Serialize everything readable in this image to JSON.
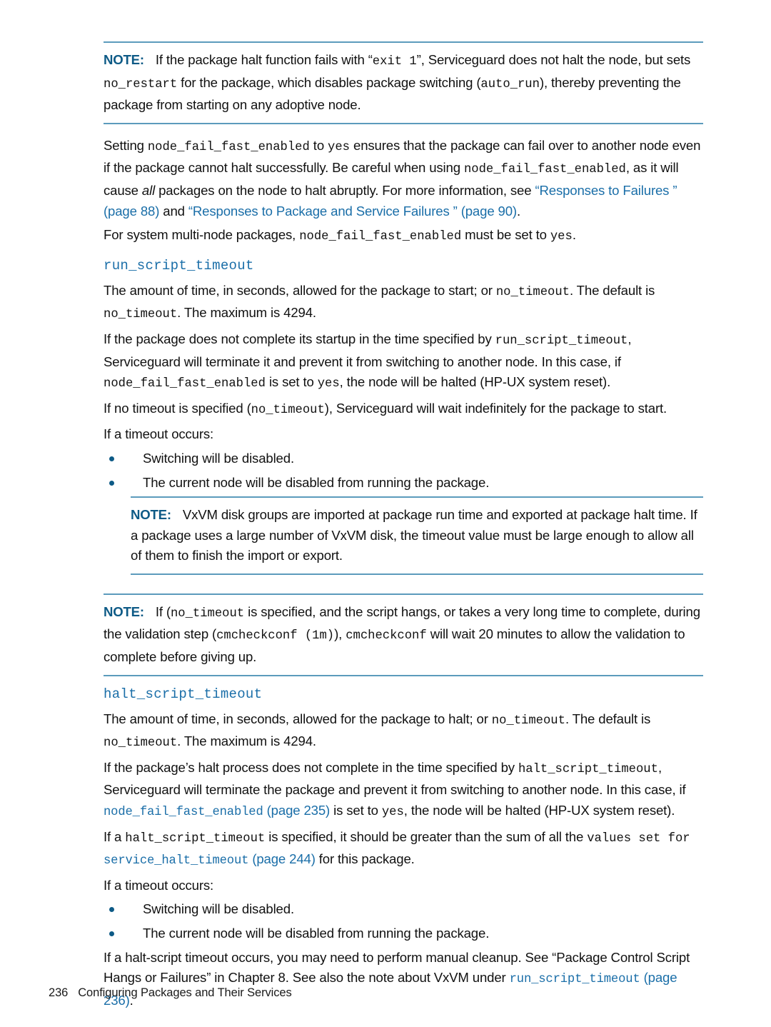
{
  "document": {
    "footer": {
      "page_number": "236",
      "chapter_title": "Configuring Packages and Their Services"
    }
  },
  "notes": {
    "note1": {
      "label": "NOTE:",
      "seg1": "If the package halt function fails with “",
      "code1": "exit 1",
      "seg2": "”, Serviceguard does not halt the node, but sets ",
      "code2": "no_restart",
      "seg3": " for the package, which disables package switching (",
      "code3": "auto_run",
      "seg4": "), thereby preventing the package from starting on any adoptive node."
    },
    "note2": {
      "label": "NOTE:",
      "seg1": "VxVM disk groups are imported at package run time and exported at package halt time. If a package uses a large number of VxVM disk, the timeout value must be large enough to allow all of them to finish the import or export."
    },
    "note3": {
      "label": "NOTE:",
      "seg1": "If (",
      "code1": "no_timeout",
      "seg2": " is specified, and the script hangs, or takes a very long time to complete, during the validation step (",
      "code2": "cmcheckconf (1m)",
      "seg3": "), ",
      "code3": "cmcheckconf",
      "seg4": " will wait 20 minutes to allow the validation to complete before giving up."
    }
  },
  "intro": {
    "para1": {
      "seg1": "Setting ",
      "code1": "node_fail_fast_enabled",
      "seg2": " to ",
      "code2": "yes",
      "seg3": " ensures that the package can fail over to another node even if the package cannot halt successfully. Be careful when using ",
      "code3": "node_fail_fast_enabled",
      "seg4": ", as it will cause ",
      "emph": "all",
      "seg5": " packages on the node to halt abruptly. For more information, see ",
      "link1": "“Responses to Failures ” (page 88)",
      "seg6": " and ",
      "link2": "“Responses to Package and Service Failures ” (page 90)",
      "seg7": "."
    },
    "para2": {
      "seg1": "For system multi-node packages, ",
      "code1": "node_fail_fast_enabled",
      "seg2": " must be set to ",
      "code2": "yes",
      "seg3": "."
    }
  },
  "run_script_timeout": {
    "heading": "run_script_timeout",
    "para1": {
      "seg1": "The amount of time, in seconds, allowed for the package to start; or ",
      "code1": "no_timeout",
      "seg2": ". The default is ",
      "code2": "no_timeout",
      "seg3": ". The maximum is 4294."
    },
    "para2": {
      "seg1": "If the package does not complete its startup in the time specified by ",
      "code1": "run_script_timeout",
      "seg2": ", Serviceguard will terminate it and prevent it from switching to another node. In this case, if ",
      "code2": "node_fail_fast_enabled",
      "seg3": " is set to ",
      "code3": "yes",
      "seg4": ", the node will be halted (HP-UX system reset)."
    },
    "para3": {
      "seg1": "If no timeout is specified (",
      "code1": "no_timeout",
      "seg2": "), Serviceguard will wait indefinitely for the package to start."
    },
    "para4": "If a timeout occurs:",
    "bullets": [
      "Switching will be disabled.",
      "The current node will be disabled from running the package."
    ]
  },
  "halt_script_timeout": {
    "heading": "halt_script_timeout",
    "para1": {
      "seg1": "The amount of time, in seconds, allowed for the package to halt; or ",
      "code1": "no_timeout",
      "seg2": ". The default is ",
      "code2": "no_timeout",
      "seg3": ". The maximum is 4294."
    },
    "para2": {
      "seg1": "If the package’s halt process does not complete in the time specified by ",
      "code1": "halt_script_timeout",
      "seg2": ", Serviceguard will terminate the package and prevent it from switching to another node. In this case, if ",
      "link1": "node_fail_fast_enabled",
      "link1_page": " (page 235)",
      "seg3": " is set to ",
      "code2": "yes",
      "seg4": ", the node will be halted (HP-UX system reset)."
    },
    "para3": {
      "seg1": "If a ",
      "code1": "halt_script_timeout",
      "seg2": " is specified, it should be greater than the sum of all the ",
      "code2": "values set for ",
      "link1": "service_halt_timeout",
      "link1_page": " (page 244)",
      "seg3": " for this package."
    },
    "para4": "If a timeout occurs:",
    "bullets": [
      "Switching will be disabled.",
      "The current node will be disabled from running the package."
    ],
    "para5": {
      "seg1": "If a halt-script timeout occurs, you may need to perform manual cleanup. See “Package Control Script Hangs or Failures” in Chapter 8. See also the note about VxVM under ",
      "link1": "run_script_timeout",
      "link1_page": " (page 236)",
      "seg2": "."
    }
  }
}
